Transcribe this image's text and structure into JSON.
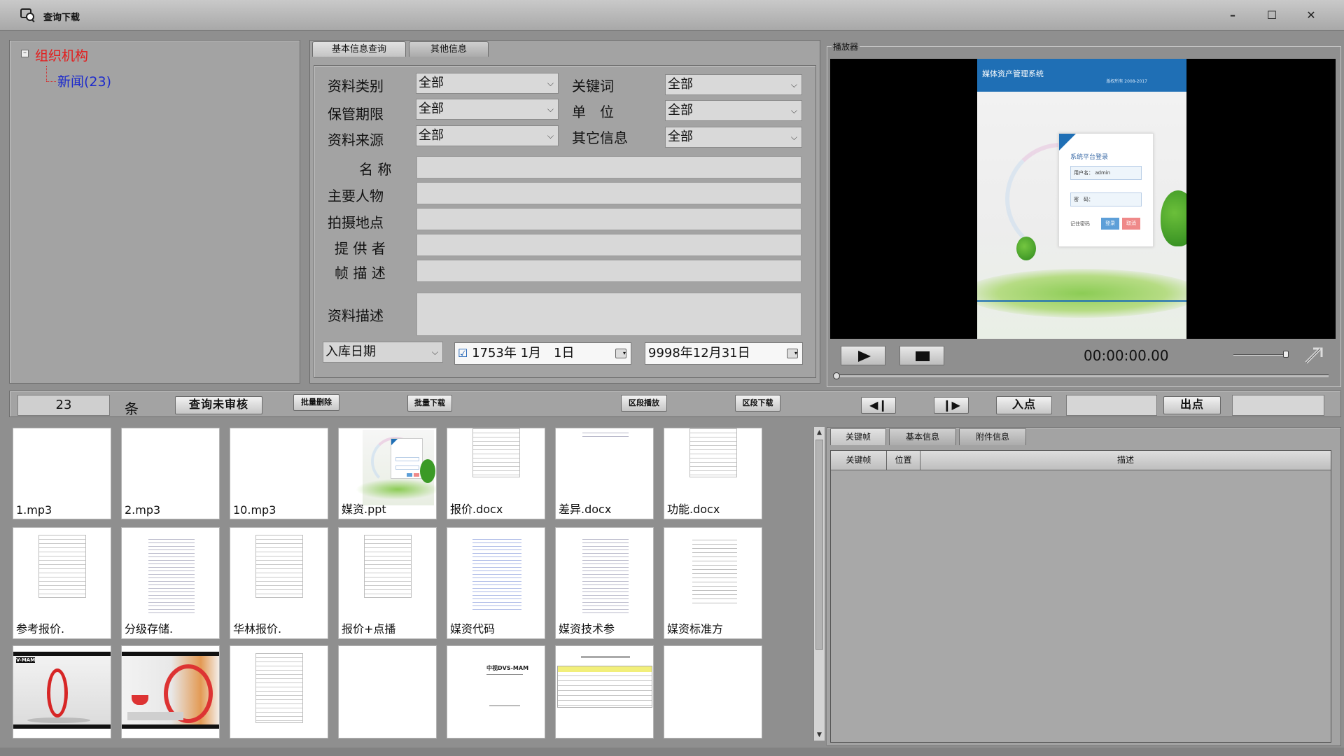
{
  "window": {
    "title": "查询下载",
    "minimize": "–",
    "maximize": "☐",
    "close": "✕"
  },
  "tree": {
    "root": "组织机构",
    "expander": "–",
    "child": "新闻(23)"
  },
  "search": {
    "tabs": [
      "基本信息查询",
      "其他信息"
    ],
    "labels": {
      "type": "资料类别",
      "keyword": "关键词",
      "retention": "保管期限",
      "unit": "单　位",
      "source": "资料来源",
      "other": "其它信息",
      "name": "名 称",
      "persons": "主要人物",
      "location": "拍摄地点",
      "provider": "提 供 者",
      "frame_desc": "帧 描 述",
      "material_desc": "资料描述"
    },
    "combos": {
      "type": "全部",
      "keyword": "全部",
      "retention": "全部",
      "unit": "全部",
      "source": "全部",
      "other": "全部"
    },
    "date_field": "入库日期",
    "date_from": "1753年 1月　1日",
    "date_to": "9998年12月31日",
    "date_from_checked": "☑"
  },
  "player": {
    "title": "播放器",
    "time": "00:00:00.00",
    "frame": {
      "header": "媒体资产管理系统",
      "header_sub": "版权所有 2008-2017",
      "login_title": "系统平台登录",
      "user_label": "用户名：",
      "user_value": "admin",
      "pass_label": "密　码：",
      "remember": "记住密码",
      "login_btn": "登录",
      "reset_btn": "取消"
    }
  },
  "toolbar": {
    "count": "23",
    "count_unit": "条",
    "query_unreviewed": "查询未审核",
    "batch_delete": "批量删除",
    "batch_download": "批量下载",
    "segment_play": "区段播放",
    "segment_download": "区段下载",
    "prev_frame": "◀❙",
    "next_frame": "❙▶",
    "in_point": "入点",
    "out_point": "出点"
  },
  "thumbnails": [
    {
      "caption": "1.mp3",
      "kind": "blank"
    },
    {
      "caption": "2.mp3",
      "kind": "blank"
    },
    {
      "caption": "10.mp3",
      "kind": "blank"
    },
    {
      "caption": "媒资.ppt",
      "kind": "ppt"
    },
    {
      "caption": "报价.docx",
      "kind": "table"
    },
    {
      "caption": "差异.docx",
      "kind": "text"
    },
    {
      "caption": "功能.docx",
      "kind": "table"
    },
    {
      "caption": "参考报价.",
      "kind": "table"
    },
    {
      "caption": "分级存储.",
      "kind": "text"
    },
    {
      "caption": "华林报价.",
      "kind": "table"
    },
    {
      "caption": "报价+点播",
      "kind": "table"
    },
    {
      "caption": "媒资代码",
      "kind": "code"
    },
    {
      "caption": "媒资技术参",
      "kind": "text"
    },
    {
      "caption": "媒资标准方",
      "kind": "toc"
    },
    {
      "caption": "",
      "kind": "red-photo"
    },
    {
      "caption": "",
      "kind": "cup-photo"
    },
    {
      "caption": "",
      "kind": "table"
    },
    {
      "caption": "",
      "kind": "blank"
    },
    {
      "caption": "",
      "kind": "cover",
      "cover_title": "中视DVS-MAM"
    },
    {
      "caption": "",
      "kind": "yellow-table"
    },
    {
      "caption": "",
      "kind": "blank"
    }
  ],
  "info": {
    "tabs": [
      "关键帧",
      "基本信息",
      "附件信息"
    ],
    "columns": [
      "关键帧",
      "位置",
      "描述"
    ]
  }
}
